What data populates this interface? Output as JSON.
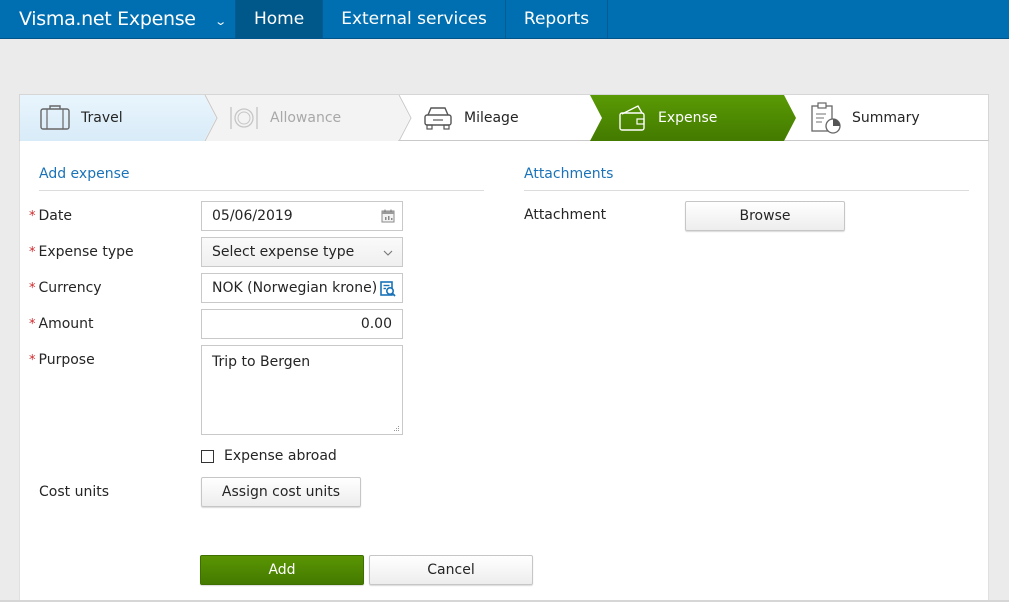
{
  "nav": {
    "app_title": "Visma.net Expense",
    "items": [
      {
        "label": "Home",
        "active": true
      },
      {
        "label": "External services",
        "active": false
      },
      {
        "label": "Reports",
        "active": false
      }
    ]
  },
  "wizard": {
    "steps": [
      {
        "label": "Travel",
        "icon": "suitcase-icon",
        "state": "visited"
      },
      {
        "label": "Allowance",
        "icon": "plate-cutlery-icon",
        "state": "disabled"
      },
      {
        "label": "Mileage",
        "icon": "car-icon",
        "state": "default"
      },
      {
        "label": "Expense",
        "icon": "wallet-icon",
        "state": "active"
      },
      {
        "label": "Summary",
        "icon": "clipboard-chart-icon",
        "state": "default"
      }
    ]
  },
  "form": {
    "title": "Add expense",
    "fields": {
      "date": {
        "label": "Date",
        "value": "05/06/2019",
        "required": true
      },
      "expense_type": {
        "label": "Expense type",
        "value": "Select expense type",
        "required": true
      },
      "currency": {
        "label": "Currency",
        "value": "NOK (Norwegian krone)",
        "required": true
      },
      "amount": {
        "label": "Amount",
        "value": "0.00",
        "required": true
      },
      "purpose": {
        "label": "Purpose",
        "value": "Trip to Bergen",
        "required": true
      }
    },
    "required_marker": "*",
    "expense_abroad": {
      "label": "Expense abroad",
      "checked": false
    },
    "cost_units": {
      "label": "Cost units",
      "button": "Assign cost units"
    },
    "add_button": "Add",
    "cancel_button": "Cancel"
  },
  "attachments": {
    "title": "Attachments",
    "label": "Attachment",
    "button": "Browse"
  },
  "colors": {
    "nav_bg": "#006fb1",
    "active_step": "#4f8a02",
    "accent_text": "#1a73b8",
    "required": "#d0282c"
  }
}
